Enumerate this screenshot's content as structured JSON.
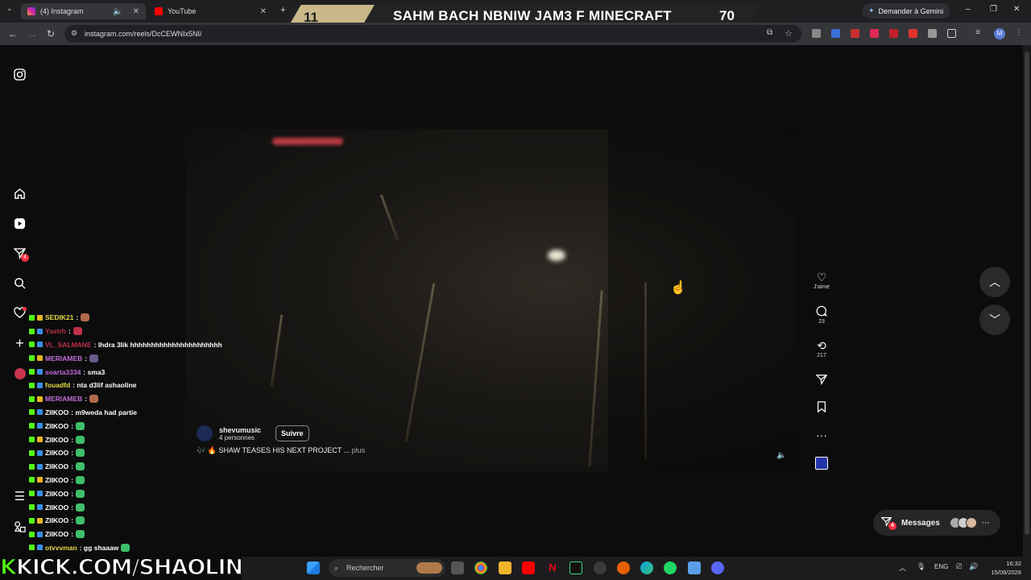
{
  "browser": {
    "tabs": [
      {
        "label": "(4) Instagram",
        "active": true
      },
      {
        "label": "YouTube",
        "active": false
      }
    ],
    "url": "instagram.com/reels/DcCEWNIx5NI/",
    "gemini_label": "Demander à Gemini",
    "profile_initial": "M"
  },
  "scoreboard": {
    "left": "11",
    "title": "SAHM BACH NBNIW JAM3 F MINECRAFT",
    "right": "70"
  },
  "sidebar": {
    "notifications_badge": "4"
  },
  "reel": {
    "owner_name": "shevumusic",
    "owner_sub": "4 personnes",
    "follow_label": "Suivre",
    "caption_prefix": "🎶 🔥",
    "caption": "SHAW TEASES HIS NEXT PROJECT ...",
    "caption_more": "plus"
  },
  "actions": {
    "like_label": "J'aime",
    "comments": "23",
    "reposts": "217"
  },
  "messages": {
    "label": "Messages",
    "badge": "4"
  },
  "chat": [
    {
      "user": "SEDIK21",
      "color": "#e6d94a",
      "msg": ":"
    },
    {
      "user": "Yastrh",
      "color": "#c0304a",
      "msg": ":"
    },
    {
      "user": "VL_SALMANE",
      "color": "#c0304a",
      "msg": ": lhdra 3lik hhhhhhhhhhhhhhhhhhhhhh"
    },
    {
      "user": "MERIAMEB",
      "color": "#c36bd9",
      "msg": ":"
    },
    {
      "user": "soarta3334",
      "color": "#c36bd9",
      "msg": ": sma3"
    },
    {
      "user": "fouadfd",
      "color": "#e6d94a",
      "msg": ": nta d3lif ashaoline"
    },
    {
      "user": "MERIAMEB",
      "color": "#c36bd9",
      "msg": ":"
    },
    {
      "user": "ZIIKOO",
      "color": "#ffffff",
      "msg": ": m9weda had partie"
    },
    {
      "user": "ZIIKOO",
      "color": "#ffffff",
      "msg": ":"
    },
    {
      "user": "ZIIKOO",
      "color": "#ffffff",
      "msg": ":"
    },
    {
      "user": "ZIIKOO",
      "color": "#ffffff",
      "msg": ":"
    },
    {
      "user": "ZIIKOO",
      "color": "#ffffff",
      "msg": ":"
    },
    {
      "user": "ZIIKOO",
      "color": "#ffffff",
      "msg": ":"
    },
    {
      "user": "ZIIKOO",
      "color": "#ffffff",
      "msg": ":"
    },
    {
      "user": "ZIIKOO",
      "color": "#ffffff",
      "msg": ":"
    },
    {
      "user": "ZIIKOO",
      "color": "#ffffff",
      "msg": ":"
    },
    {
      "user": "ZIIKOO",
      "color": "#ffffff",
      "msg": ":"
    },
    {
      "user": "otvvvman",
      "color": "#e6d94a",
      "msg": ": gg shaaaw"
    }
  ],
  "overlay": {
    "kick_k": "K",
    "kick_rest": "KICK.COM/SHAOLINE"
  },
  "taskbar": {
    "search_placeholder": "Rechercher",
    "lang": "ENG",
    "time": "16:32",
    "date": "15/08/2026"
  },
  "colors": {
    "accent_badge": "#ff3040",
    "kick_green": "#53fc18"
  }
}
